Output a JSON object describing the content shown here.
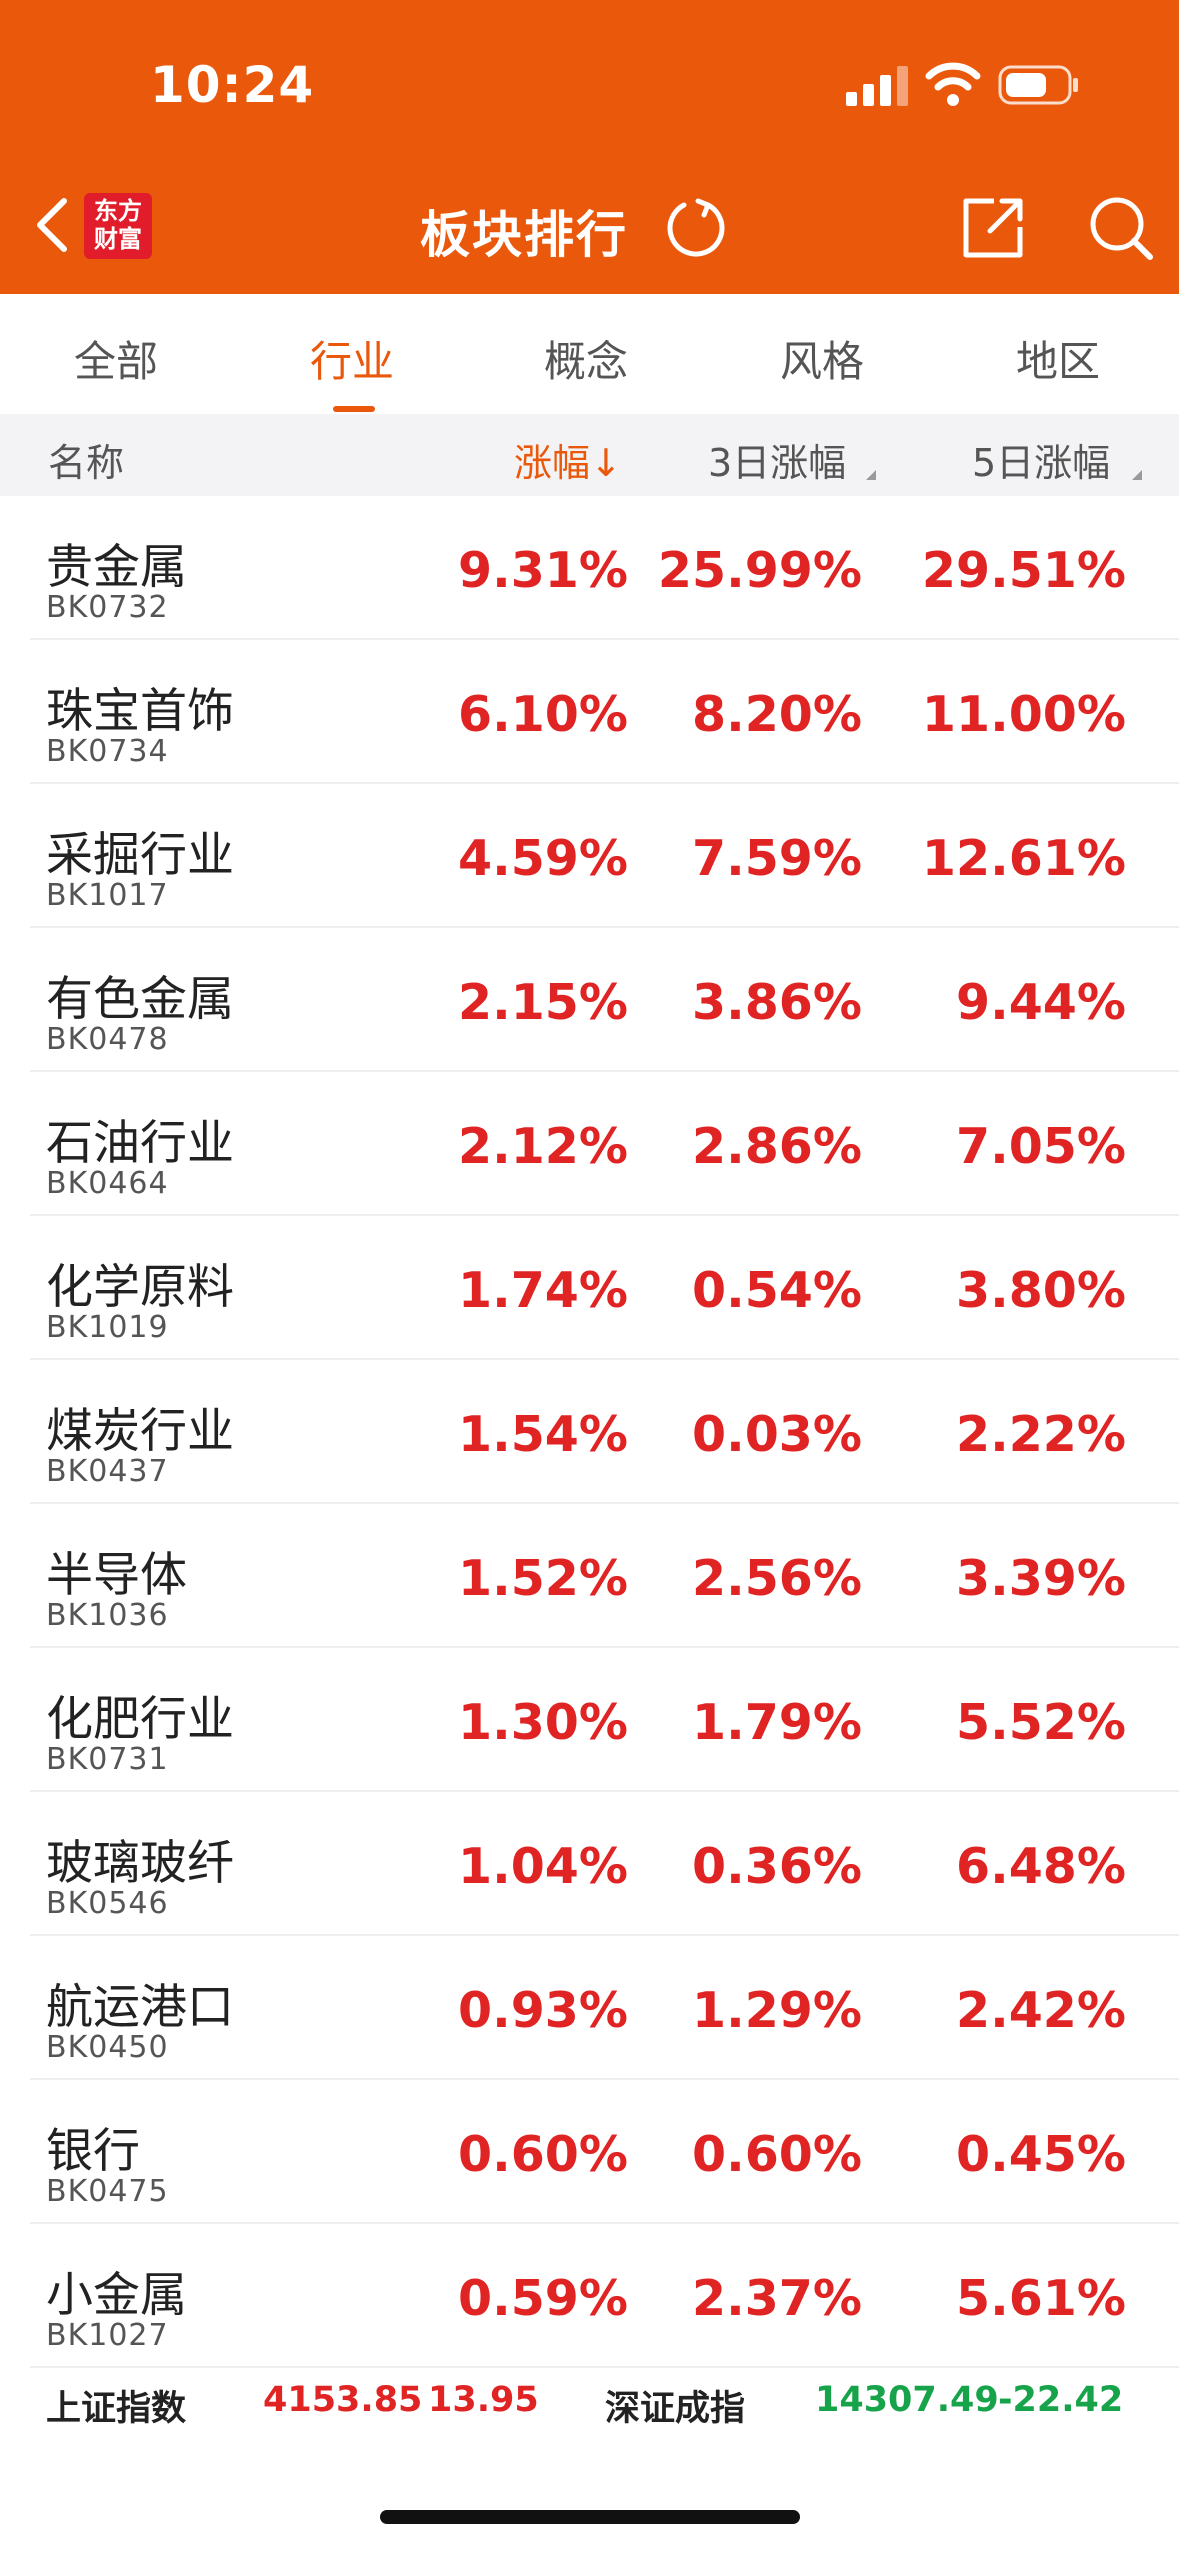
{
  "status_bar": {
    "time": "10:24"
  },
  "header": {
    "brand_line1": "东方",
    "brand_line2": "财富",
    "title": "板块排行"
  },
  "tabs": [
    {
      "label": "全部"
    },
    {
      "label": "行业"
    },
    {
      "label": "概念"
    },
    {
      "label": "风格"
    },
    {
      "label": "地区"
    }
  ],
  "columns": {
    "name": "名称",
    "change": "涨幅",
    "change_sort": "↓",
    "change_3d": "3日涨幅",
    "change_5d": "5日涨幅"
  },
  "rows": [
    {
      "name": "贵金属",
      "code": "BK0732",
      "chg": "9.31%",
      "chg3": "25.99%",
      "chg5": "29.51%"
    },
    {
      "name": "珠宝首饰",
      "code": "BK0734",
      "chg": "6.10%",
      "chg3": "8.20%",
      "chg5": "11.00%"
    },
    {
      "name": "采掘行业",
      "code": "BK1017",
      "chg": "4.59%",
      "chg3": "7.59%",
      "chg5": "12.61%"
    },
    {
      "name": "有色金属",
      "code": "BK0478",
      "chg": "2.15%",
      "chg3": "3.86%",
      "chg5": "9.44%"
    },
    {
      "name": "石油行业",
      "code": "BK0464",
      "chg": "2.12%",
      "chg3": "2.86%",
      "chg5": "7.05%"
    },
    {
      "name": "化学原料",
      "code": "BK1019",
      "chg": "1.74%",
      "chg3": "0.54%",
      "chg5": "3.80%"
    },
    {
      "name": "煤炭行业",
      "code": "BK0437",
      "chg": "1.54%",
      "chg3": "0.03%",
      "chg5": "2.22%"
    },
    {
      "name": "半导体",
      "code": "BK1036",
      "chg": "1.52%",
      "chg3": "2.56%",
      "chg5": "3.39%"
    },
    {
      "name": "化肥行业",
      "code": "BK0731",
      "chg": "1.30%",
      "chg3": "1.79%",
      "chg5": "5.52%"
    },
    {
      "name": "玻璃玻纤",
      "code": "BK0546",
      "chg": "1.04%",
      "chg3": "0.36%",
      "chg5": "6.48%"
    },
    {
      "name": "航运港口",
      "code": "BK0450",
      "chg": "0.93%",
      "chg3": "1.29%",
      "chg5": "2.42%"
    },
    {
      "name": "银行",
      "code": "BK0475",
      "chg": "0.60%",
      "chg3": "0.60%",
      "chg5": "0.45%"
    },
    {
      "name": "小金属",
      "code": "BK1027",
      "chg": "0.59%",
      "chg3": "2.37%",
      "chg5": "5.61%"
    }
  ],
  "footer": {
    "sh_name": "上证指数",
    "sh_value": "4153.85",
    "sh_change": "13.95",
    "sz_name": "深证成指",
    "sz_value": "14307.49",
    "sz_change": "-22.42"
  },
  "colors": {
    "brand_orange": "#ea580c",
    "up_red": "#e02424",
    "down_green": "#16a34a",
    "brand_logo_red": "#e11d2b"
  },
  "icons": [
    "back-arrow-icon",
    "refresh-icon",
    "share-icon",
    "search-icon",
    "signal-icon",
    "wifi-icon",
    "battery-icon"
  ]
}
